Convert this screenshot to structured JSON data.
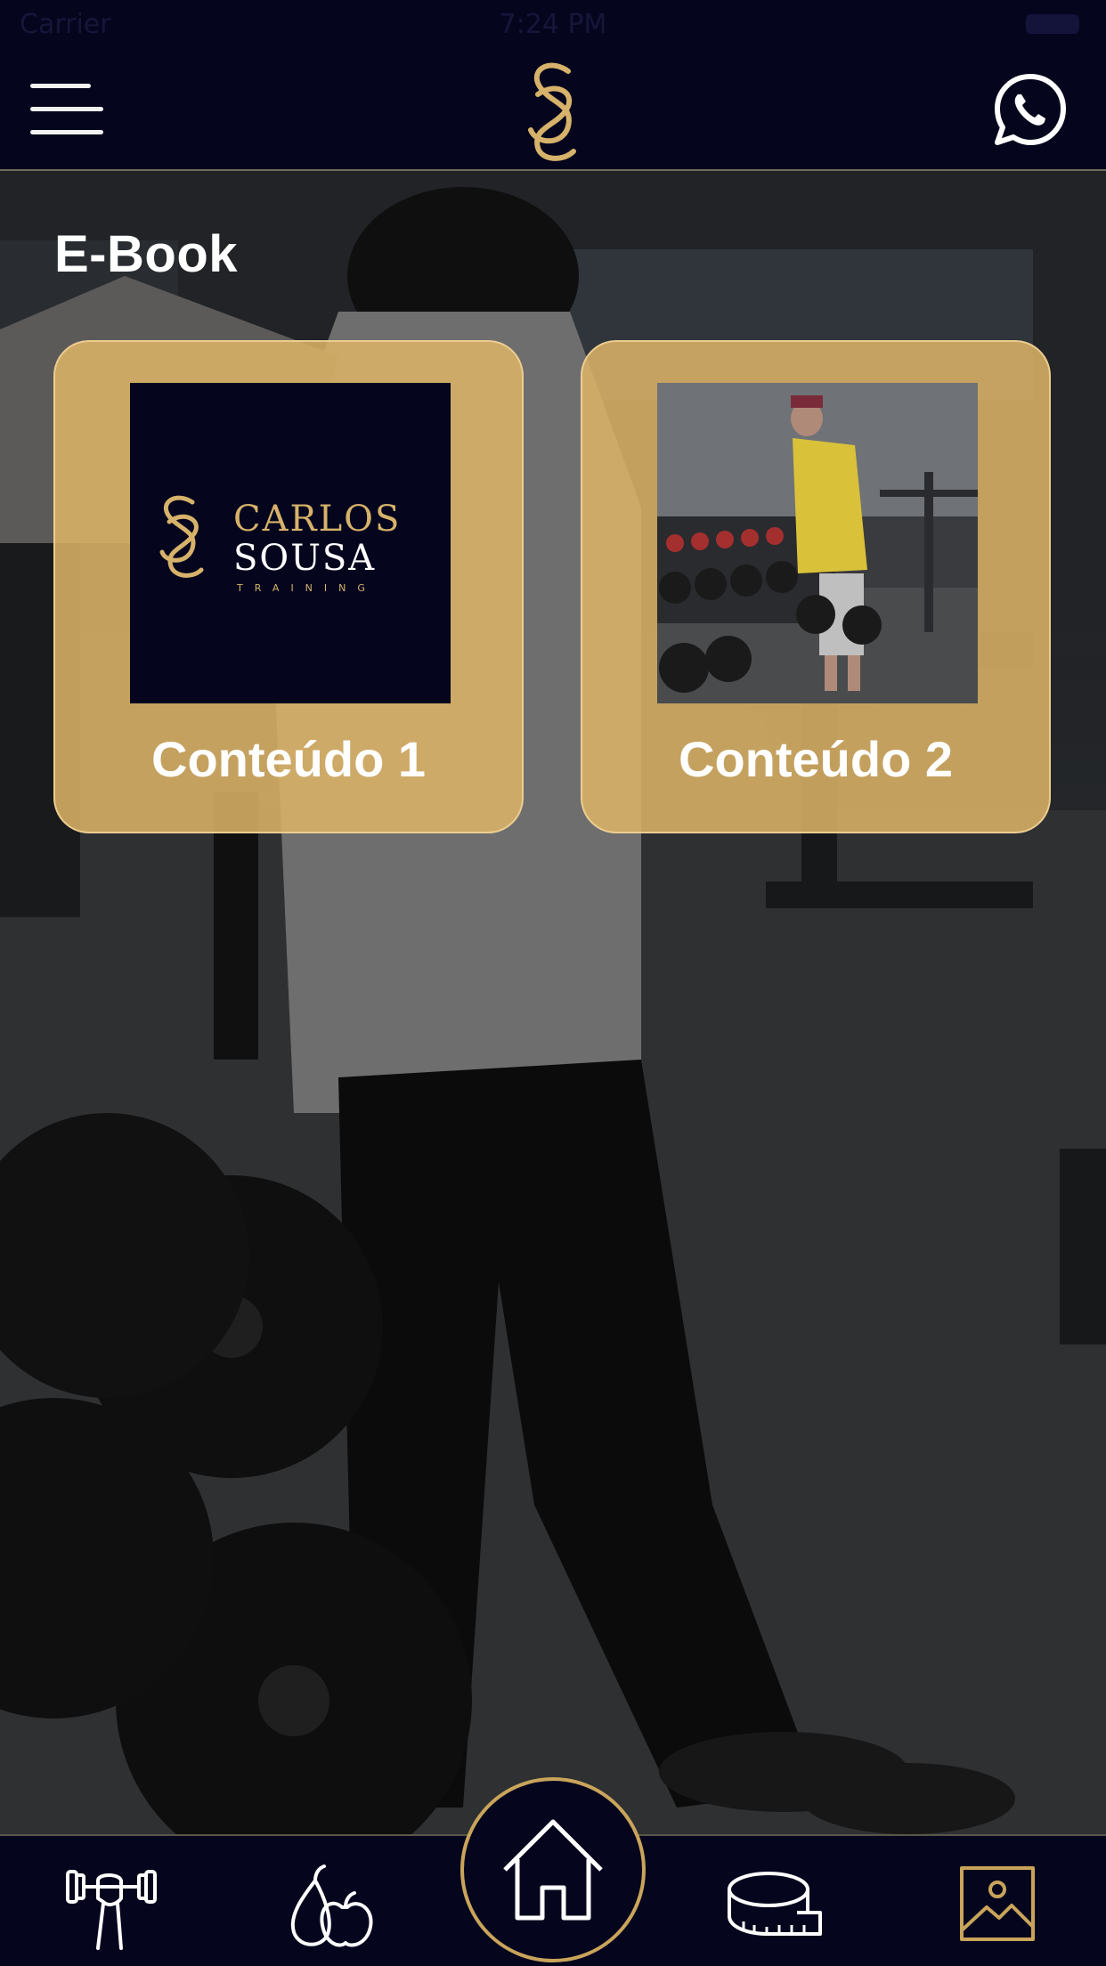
{
  "status_bar": {
    "carrier": "Carrier",
    "time": "7:24 PM"
  },
  "header": {
    "logo_text": "CS"
  },
  "page": {
    "title": "E-Book"
  },
  "cards": [
    {
      "label": "Conteúdo 1",
      "thumb_logo": {
        "line1": "CARLOS",
        "line2": "SOUSA",
        "line3": "TRAINING"
      }
    },
    {
      "label": "Conteúdo 2"
    }
  ],
  "bottom_nav": {
    "items": [
      "workout-icon",
      "nutrition-icon",
      "home-icon",
      "measurements-icon",
      "gallery-icon"
    ]
  },
  "colors": {
    "navy": "#05051e",
    "gold": "#c9a45a",
    "card_gold": "#deb468"
  }
}
